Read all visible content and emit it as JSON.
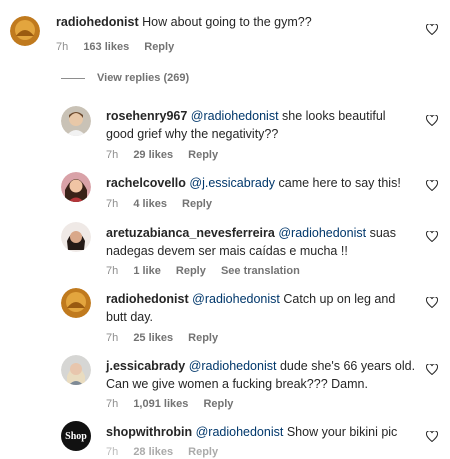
{
  "comments": [
    {
      "user": "radiohedonist",
      "mention": "",
      "text": "How about going to the gym??",
      "time": "7h",
      "likes": "163 likes",
      "reply": "Reply"
    },
    {
      "user": "rosehenry967",
      "mention": "@radiohedonist",
      "text": "she looks beautiful good grief why the negativity??",
      "time": "7h",
      "likes": "29 likes",
      "reply": "Reply"
    },
    {
      "user": "rachelcovello",
      "mention": "@j.essicabrady",
      "text": "came here to say this!",
      "time": "7h",
      "likes": "4 likes",
      "reply": "Reply"
    },
    {
      "user": "aretuzabianca_nevesferreira",
      "mention": "@radiohedonist",
      "text": "suas nadegas devem ser mais caídas e mucha !!",
      "time": "7h",
      "likes": "1 like",
      "reply": "Reply",
      "translate": "See translation"
    },
    {
      "user": "radiohedonist",
      "mention": "@radiohedonist",
      "text": "Catch up on leg and butt day.",
      "time": "7h",
      "likes": "25 likes",
      "reply": "Reply"
    },
    {
      "user": "j.essicabrady",
      "mention": "@radiohedonist",
      "text": "dude she's 66 years old. Can we give women a fucking break??? Damn.",
      "time": "7h",
      "likes": "1,091 likes",
      "reply": "Reply"
    },
    {
      "user": "shopwithrobin",
      "mention": "@radiohedonist",
      "text": "Show your bikini pic",
      "time": "7h",
      "likes": "28 likes",
      "reply": "Reply"
    }
  ],
  "view_replies": "View replies (269)",
  "avatar_shop_text": "Shop",
  "icons": {
    "heart": "heart-outline-icon"
  },
  "colors": {
    "mention": "#00376b",
    "meta": "#8e8e8e"
  }
}
